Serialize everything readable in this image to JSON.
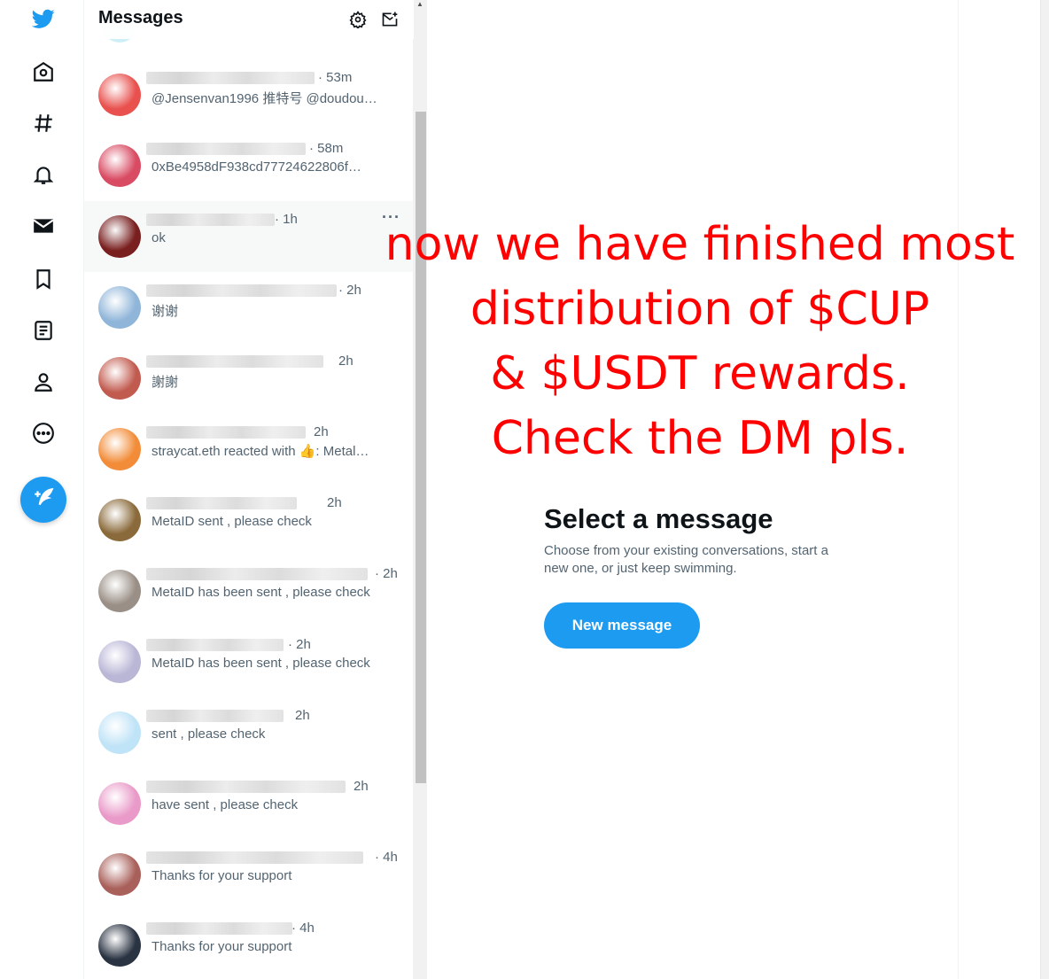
{
  "sidebar": {
    "icons": [
      "twitter-logo-icon",
      "home-icon",
      "explore-hashtag-icon",
      "notifications-bell-icon",
      "messages-envelope-icon",
      "bookmarks-icon",
      "lists-icon",
      "profile-icon",
      "more-circle-icon",
      "compose-tweet-icon"
    ],
    "brand_color": "#1d9bf0"
  },
  "messages_panel": {
    "title": "Messages",
    "conversations": [
      {
        "time": "· 53m",
        "preview": "@Jensenvan1996 推特号 @doudou…",
        "avatar_color": "#e8514e"
      },
      {
        "time": "· 58m",
        "preview": "0xBe4958dF938cd77724622806f…",
        "avatar_color": "#d94b63"
      },
      {
        "time": "· 1h",
        "preview": "ok",
        "avatar_color": "#7a1f1f",
        "selected": true
      },
      {
        "time": "· 2h",
        "preview": "谢谢",
        "avatar_color": "#8fb5d9"
      },
      {
        "time": "2h",
        "preview": "謝謝",
        "avatar_color": "#c25b4f"
      },
      {
        "time": "2h",
        "preview": "straycat.eth reacted with 👍: Metal…",
        "avatar_color": "#f28c38"
      },
      {
        "time": "2h",
        "preview": "MetaID sent , please check",
        "avatar_color": "#8a6a3a"
      },
      {
        "time": "· 2h",
        "preview": "MetaID has been sent , please check",
        "avatar_color": "#9a8f86"
      },
      {
        "time": "· 2h",
        "preview": "MetaID has been sent , please check",
        "avatar_color": "#b9b6d6"
      },
      {
        "time": "2h",
        "preview": "sent , please check",
        "avatar_color": "#bfe3f7"
      },
      {
        "time": "2h",
        "preview": "have sent , please check",
        "avatar_color": "#e99ac8"
      },
      {
        "time": "· 4h",
        "preview": "Thanks for your support",
        "avatar_color": "#a9605a"
      },
      {
        "time": "· 4h",
        "preview": "Thanks for your support",
        "avatar_color": "#2a3342"
      }
    ]
  },
  "overlay_text": {
    "line1": "now we have finished most",
    "line2": "distribution of $CUP",
    "line3": "& $USDT rewards.",
    "line4": "Check the DM pls.",
    "color": "#ff0000"
  },
  "empty_state": {
    "title": "Select a message",
    "description": "Choose from your existing conversations, start a new one, or just keep swimming.",
    "button_label": "New message"
  }
}
